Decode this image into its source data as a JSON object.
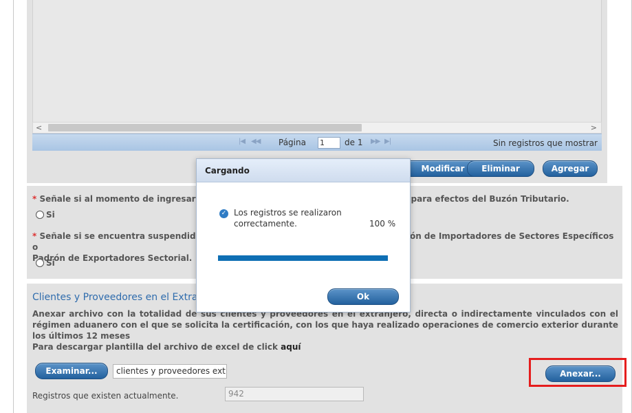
{
  "grid": {
    "pager": {
      "page_label": "Página",
      "page_value": "1",
      "of_label": "de 1",
      "status": "Sin registros que mostrar"
    },
    "buttons": {
      "modify": "Modificar",
      "delete": "Eliminar",
      "add": "Agregar"
    }
  },
  "questions": {
    "q1_text": "Señale si al momento de ingresar su solicitud cuenta con un correo electrónico para efectos del Buzón Tributario.",
    "q1_option": "Si",
    "q2_line1": "Señale si se encuentra suspendido en el Padrón de Importadores y/o en el Padrón de Importadores de Sectores Específicos o",
    "q2_line2": "Padrón de Exportadores Sectorial.",
    "q2_option": "Si"
  },
  "clients": {
    "title": "Clientes y Proveedores en el Extranjero",
    "description": "Anexar archivo con la totalidad de sus clientes y proveedores en el extranjero, directa o indirectamente vinculados con el régimen aduanero con el que se solicita la certificación, con los que haya realizado operaciones de comercio exterior durante los últimos 12 meses",
    "download_prefix": "Para descargar plantilla del archivo de excel de click ",
    "download_link": "aquí",
    "browse_button": "Examinar...",
    "file_name": "clientes y proveedores extr",
    "attach_button": "Anexar...",
    "records_label": "Registros que existen actualmente.",
    "records_value": "942"
  },
  "modal": {
    "title": "Cargando",
    "message": "Los registros se realizaron correctamente.",
    "percent_label": "100 %",
    "progress": 1.0,
    "ok_button": "Ok"
  },
  "colors": {
    "accent": "#2f6cad",
    "button": "#23619e",
    "progress": "#0f6fb4",
    "highlight": "#e51d1d"
  }
}
